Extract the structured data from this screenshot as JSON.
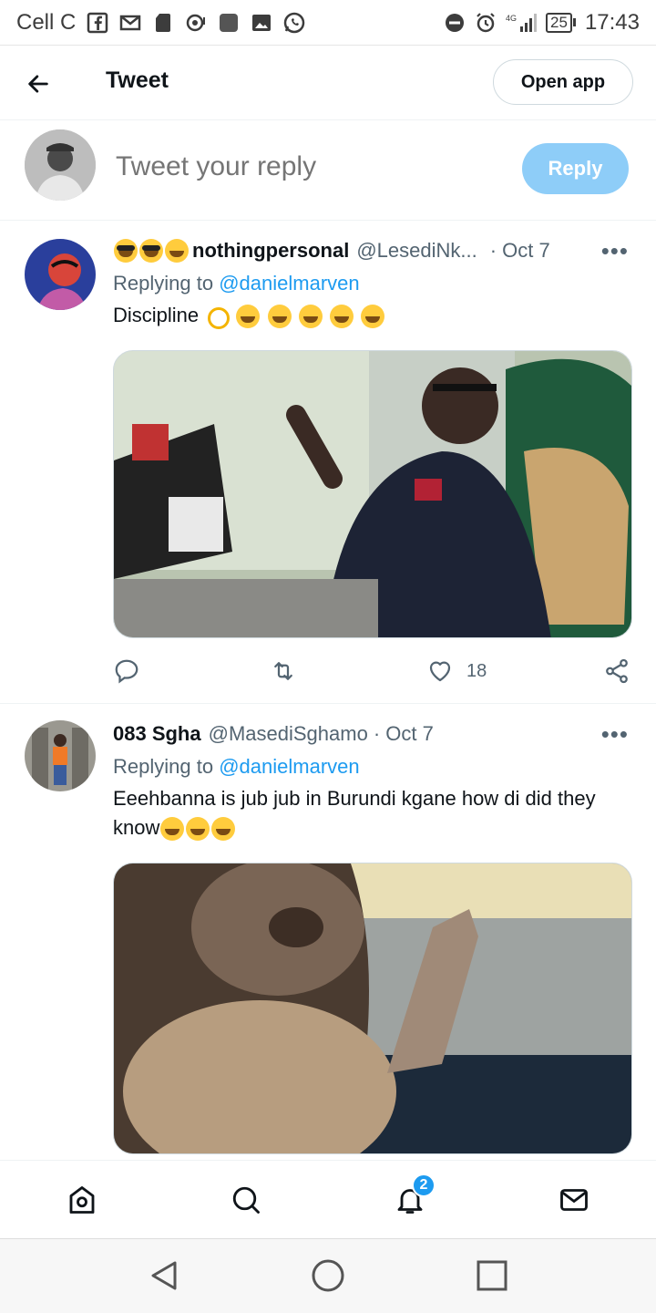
{
  "status_bar": {
    "carrier": "Cell C",
    "network": "4G",
    "battery": "25",
    "time": "17:43"
  },
  "header": {
    "title": "Tweet",
    "open_app_label": "Open app"
  },
  "compose": {
    "placeholder": "Tweet your reply",
    "reply_label": "Reply"
  },
  "tweets": [
    {
      "name": "nothingpersonal",
      "handle": "@LesediNk...",
      "date": "· Oct 7",
      "replying_prefix": "Replying to",
      "replying_to": "@danielmarven",
      "text": "Discipline",
      "like_count": "18"
    },
    {
      "name": "083 Sgha",
      "handle": "@MasediSghamo",
      "date": "· Oct 7",
      "replying_prefix": "Replying to",
      "replying_to": "@danielmarven",
      "text": "Eeehbanna is jub jub in Burundi kgane how di did they know"
    }
  ],
  "bottom_nav": {
    "notifications_badge": "2"
  },
  "colors": {
    "accent": "#1d9bf0",
    "reply_disabled": "#8ecdf8",
    "text_secondary": "#536471"
  }
}
